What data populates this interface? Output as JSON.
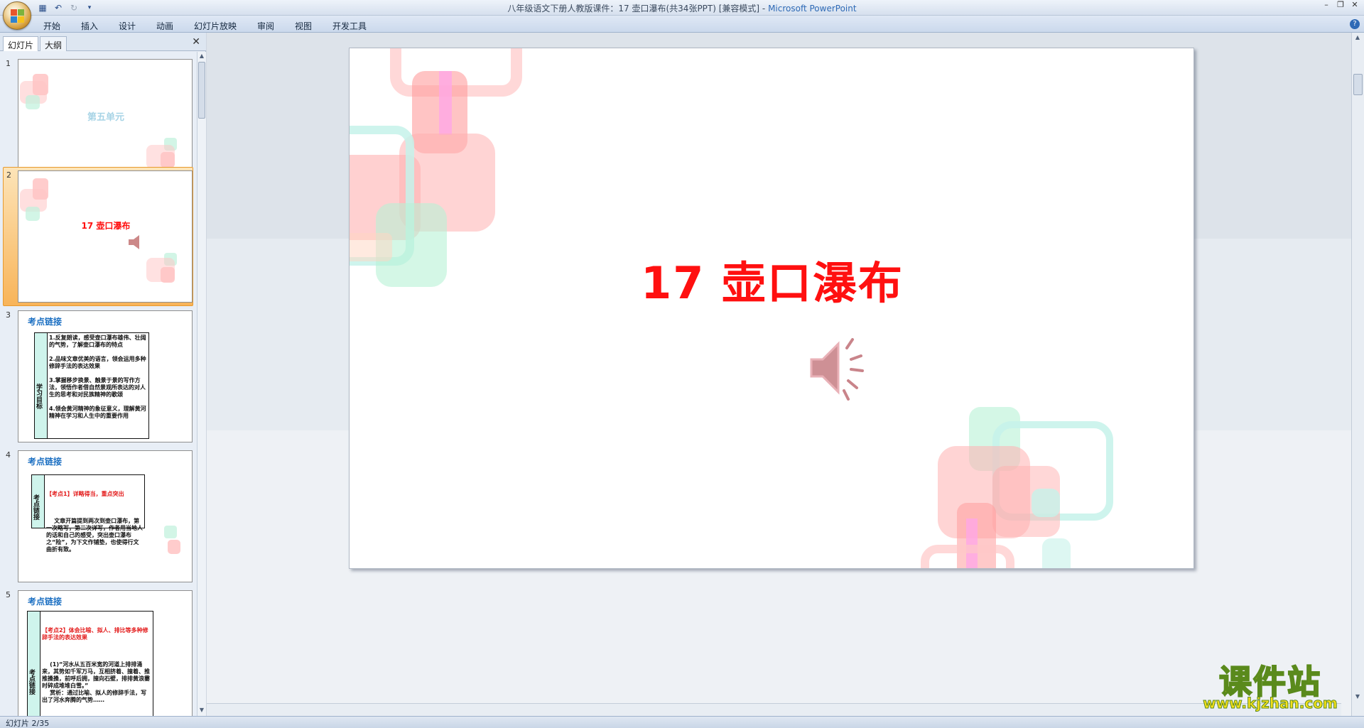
{
  "window": {
    "title_doc": "八年级语文下册人教版课件：17 壶口瀑布(共34张PPT) [兼容模式]",
    "title_sep": " - ",
    "title_app": "Microsoft PowerPoint"
  },
  "ribbon": {
    "tabs": [
      "开始",
      "插入",
      "设计",
      "动画",
      "幻灯片放映",
      "审阅",
      "视图",
      "开发工具"
    ]
  },
  "pane": {
    "tab_slides": "幻灯片",
    "tab_outline": "大纲",
    "close": "✕"
  },
  "thumbnails": [
    {
      "num": "1",
      "title": "第五单元"
    },
    {
      "num": "2",
      "title": "17  壶口瀑布"
    },
    {
      "num": "3",
      "heading": "考点链接",
      "side": "学习目标",
      "body": "1.反复朗读，感受壶口瀑布雄伟、壮阔的气势，了解壶口瀑布的特点\n\n2.品味文章优美的语言，领会运用多种修辞手法的表达效果\n\n3.掌握移步换景、触景于景的写作方法，领悟作者借自然景观所表达的对人生的思考和对民族精神的歌颂\n\n4.领会黄河精神的象征意义，理解黄河精神在学习和人生中的重要作用"
    },
    {
      "num": "4",
      "heading": "考点链接",
      "side": "考点链接",
      "point": "【考点1】详略得当，重点突出",
      "body": "    文章开篇提到两次到壶口瀑布，第一次略写，第二次详写，作者用当地人的话和自己的感受，突出壶口瀑布之“险”，为下文作铺垫，也使得行文曲折有致。"
    },
    {
      "num": "5",
      "heading": "考点链接",
      "side": "考点链接",
      "point": "【考点2】体会比喻、拟人、排比等多种修辞手法的表达效果",
      "body": "    (1)“河水从五百米宽的河道上排排涌来，其势如千军万马，互相挤着、撞着、推推搡搡，前呼后拥，撞向石壁，排排黄浪霎时碎成堆堆白雪。”\n    赏析：通过比喻、拟人的修辞手法，写出了河水奔腾的气势……"
    }
  ],
  "slide": {
    "title": "17  壶口瀑布"
  },
  "status": {
    "slide_info": "幻灯片 2/35"
  },
  "watermark": {
    "brand": "课件站",
    "url": "www.kjzhan.com"
  },
  "colors": {
    "title_red": "#ff1010",
    "thumb_heading": "#1b6fc2",
    "selected_slot": "#f8b459"
  }
}
